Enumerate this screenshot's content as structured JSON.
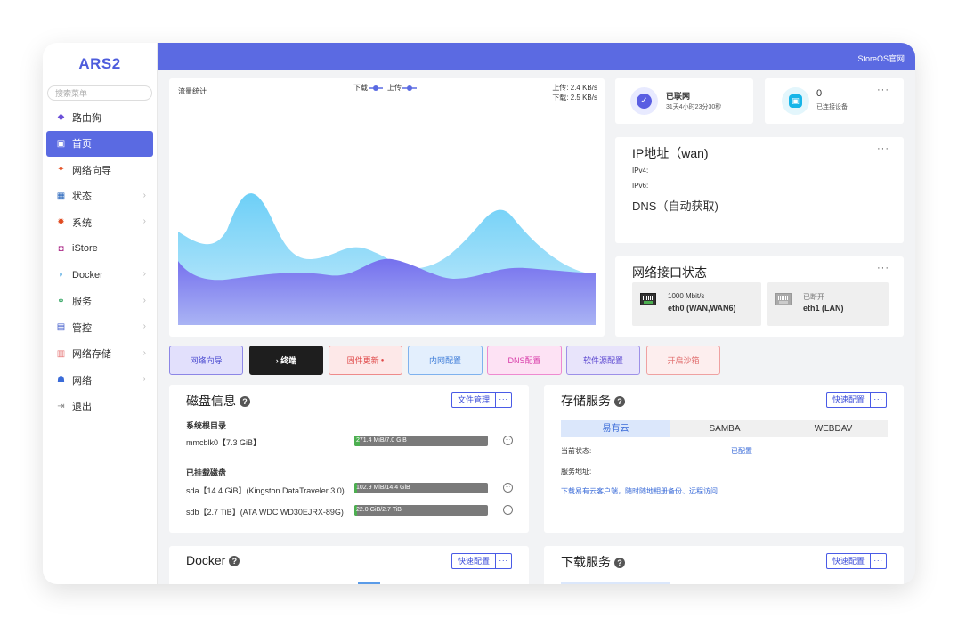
{
  "app": {
    "logo": "ARS2",
    "topbar_link": "iStoreOS官网"
  },
  "sidebar": {
    "search_placeholder": "搜索菜单",
    "items": [
      {
        "label": "路由狗",
        "icon": "cube-icon",
        "color": "#6b4fd8"
      },
      {
        "label": "首页",
        "icon": "home-icon",
        "active": true
      },
      {
        "label": "网络向导",
        "icon": "wizard-icon",
        "color": "#e5552a"
      },
      {
        "label": "状态",
        "icon": "status-icon",
        "color": "#1f5fb8",
        "chevron": "›"
      },
      {
        "label": "系统",
        "icon": "gear-icon",
        "color": "#e04a20",
        "chevron": "›"
      },
      {
        "label": "iStore",
        "icon": "store-icon",
        "color": "#b0368f"
      },
      {
        "label": "Docker",
        "icon": "docker-icon",
        "color": "#1d8fd8",
        "chevron": "›"
      },
      {
        "label": "服务",
        "icon": "services-icon",
        "color": "#28a05a",
        "chevron": "›"
      },
      {
        "label": "管控",
        "icon": "control-icon",
        "color": "#3a55c8",
        "chevron": "›"
      },
      {
        "label": "网络存储",
        "icon": "storage-icon",
        "color": "#e57373",
        "chevron": "›"
      },
      {
        "label": "网络",
        "icon": "network-icon",
        "color": "#3a6bd8",
        "chevron": "›"
      },
      {
        "label": "退出",
        "icon": "logout-icon",
        "color": "#888"
      }
    ]
  },
  "traffic": {
    "title": "流量统计",
    "legend_down": "下载",
    "legend_up": "上传",
    "upload_rate": "上传: 2.4 KB/s",
    "download_rate": "下载: 2.5 KB/s"
  },
  "status_card": {
    "title": "已联网",
    "uptime": "31天4小时23分30秒"
  },
  "devices_card": {
    "count": "0",
    "label": "已连接设备"
  },
  "ip_card": {
    "title": "IP地址（wan)",
    "ipv4": "IPv4:",
    "ipv6": "IPv6:",
    "dns": "DNS（自动获取)"
  },
  "ports_card": {
    "title": "网络接口状态",
    "ports": [
      {
        "speed": "1000 Mbit/s",
        "name": "eth0 (WAN,WAN6)"
      },
      {
        "speed": "已断开",
        "name": "eth1 (LAN)"
      }
    ]
  },
  "actions": [
    {
      "label": "网络向导",
      "bg": "#e2e0fc",
      "border": "#8c86e6",
      "color": "#4a4ad0"
    },
    {
      "label": "› 终端",
      "bg": "#1e1e1e",
      "border": "#1e1e1e",
      "color": "#ffffff"
    },
    {
      "label": "固件更新",
      "bg": "#fde8e8",
      "border": "#ee8a8a",
      "color": "#e04a4a",
      "dot": "●"
    },
    {
      "label": "内网配置",
      "bg": "#e3effd",
      "border": "#7fb2ee",
      "color": "#3b7bd8"
    },
    {
      "label": "DNS配置",
      "bg": "#fde2f4",
      "border": "#ee8ad0",
      "color": "#d83aa8"
    },
    {
      "label": "软件源配置",
      "bg": "#e8e4fb",
      "border": "#9d90e8",
      "color": "#5a46d0"
    },
    {
      "label": "开启沙箱",
      "bg": "#fdeeee",
      "border": "#efa1a1",
      "color": "#e06a6a"
    }
  ],
  "disk": {
    "title": "磁盘信息",
    "file_mgr": "文件管理",
    "more": "···",
    "root_title": "系统根目录",
    "mounted_title": "已挂载磁盘",
    "disks": [
      {
        "name": "mmcblk0【7.3 GiB】",
        "usage": "271.4 MiB/7.0 GiB",
        "ratio": 0.04
      },
      {
        "name": "sda【14.4 GiB】(Kingston DataTraveler 3.0)",
        "usage": "102.9 MiB/14.4 GiB",
        "ratio": 0.01
      },
      {
        "name": "sdb【2.7 TiB】(ATA WDC WD30EJRX-89G)",
        "usage": "22.0 GiB/2.7 TiB",
        "ratio": 0.01
      }
    ]
  },
  "storage": {
    "title": "存储服务",
    "quick": "快速配置",
    "more": "···",
    "tabs": [
      "易有云",
      "SAMBA",
      "WEBDAV"
    ],
    "state_label": "当前状态:",
    "state_value": "已配置",
    "addr_label": "服务地址:",
    "link": "下载易有云客户端，随时随地相册备份、远程访问"
  },
  "docker": {
    "title": "Docker",
    "quick": "快速配置",
    "more": "···"
  },
  "download": {
    "title": "下载服务",
    "quick": "快速配置",
    "more": "···"
  }
}
